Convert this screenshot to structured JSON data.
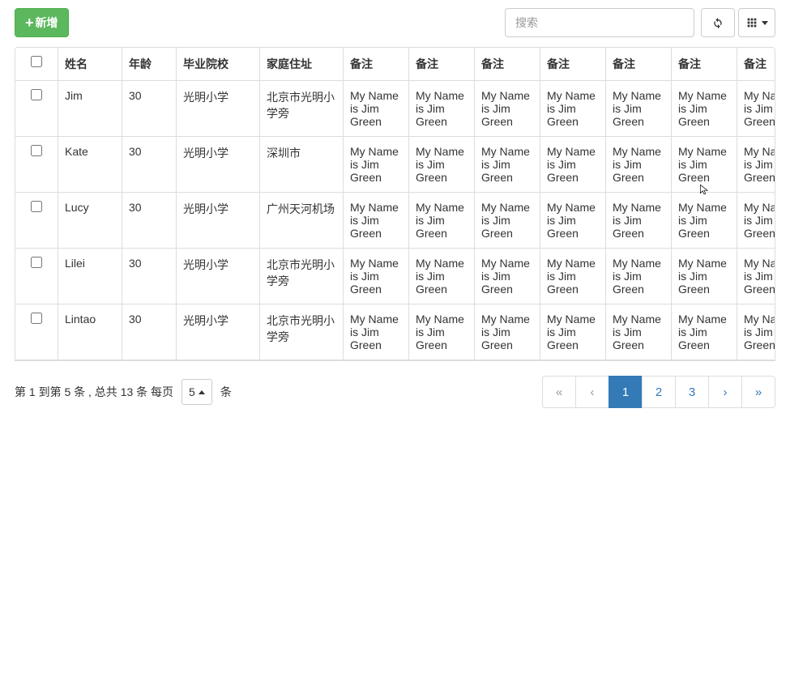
{
  "toolbar": {
    "add_label": "新增",
    "search_placeholder": "搜索"
  },
  "table": {
    "headers": {
      "name": "姓名",
      "age": "年龄",
      "school": "毕业院校",
      "address": "家庭住址",
      "remark": "备注"
    },
    "remark_value": "My Name is Jim Green",
    "rows": [
      {
        "name": "Jim",
        "age": "30",
        "school": "光明小学",
        "address": "北京市光明小学旁"
      },
      {
        "name": "Kate",
        "age": "30",
        "school": "光明小学",
        "address": "深圳市"
      },
      {
        "name": "Lucy",
        "age": "30",
        "school": "光明小学",
        "address": "广州天河机场"
      },
      {
        "name": "Lilei",
        "age": "30",
        "school": "光明小学",
        "address": "北京市光明小学旁"
      },
      {
        "name": "Lintao",
        "age": "30",
        "school": "光明小学",
        "address": "北京市光明小学旁"
      }
    ]
  },
  "footer": {
    "info_prefix": "第 1 到第 5 条 , 总共 13 条 每页",
    "page_size": "5",
    "info_suffix": "条",
    "pagination": {
      "first": "«",
      "prev": "‹",
      "pages": [
        "1",
        "2",
        "3"
      ],
      "active": "1",
      "next": "›",
      "last": "»"
    }
  }
}
